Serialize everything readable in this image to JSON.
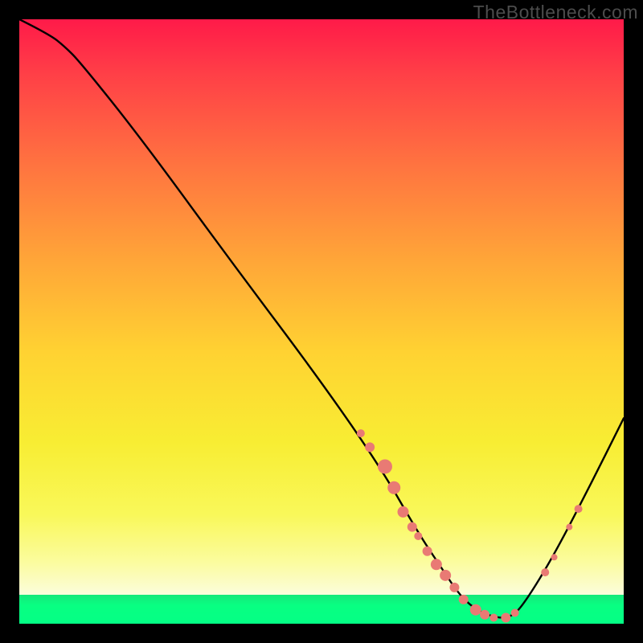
{
  "watermark": "TheBottleneck.com",
  "chart_data": {
    "type": "line",
    "title": "",
    "xlabel": "",
    "ylabel": "",
    "xlim": [
      0,
      100
    ],
    "ylim": [
      0,
      100
    ],
    "curve": {
      "name": "bottleneck-curve",
      "points": [
        {
          "x": 0.0,
          "y": 100.0
        },
        {
          "x": 5.0,
          "y": 97.5
        },
        {
          "x": 7.5,
          "y": 95.5
        },
        {
          "x": 10.0,
          "y": 93.0
        },
        {
          "x": 20.0,
          "y": 80.5
        },
        {
          "x": 35.0,
          "y": 60.0
        },
        {
          "x": 50.0,
          "y": 40.0
        },
        {
          "x": 60.0,
          "y": 25.5
        },
        {
          "x": 66.0,
          "y": 15.0
        },
        {
          "x": 70.0,
          "y": 9.0
        },
        {
          "x": 73.0,
          "y": 4.5
        },
        {
          "x": 76.0,
          "y": 2.0
        },
        {
          "x": 79.0,
          "y": 1.0
        },
        {
          "x": 81.0,
          "y": 1.0
        },
        {
          "x": 83.0,
          "y": 2.5
        },
        {
          "x": 88.0,
          "y": 10.5
        },
        {
          "x": 94.0,
          "y": 22.0
        },
        {
          "x": 100.0,
          "y": 34.0
        }
      ]
    },
    "marker_series": {
      "name": "highlighted-points",
      "color": "#e97a74",
      "points": [
        {
          "x": 56.5,
          "y": 31.5,
          "r": 5
        },
        {
          "x": 58.0,
          "y": 29.2,
          "r": 6
        },
        {
          "x": 60.5,
          "y": 26.0,
          "r": 9
        },
        {
          "x": 62.0,
          "y": 22.5,
          "r": 8
        },
        {
          "x": 63.5,
          "y": 18.5,
          "r": 7
        },
        {
          "x": 65.0,
          "y": 16.0,
          "r": 6
        },
        {
          "x": 66.0,
          "y": 14.5,
          "r": 5
        },
        {
          "x": 67.5,
          "y": 12.0,
          "r": 6
        },
        {
          "x": 69.0,
          "y": 9.8,
          "r": 7
        },
        {
          "x": 70.5,
          "y": 8.0,
          "r": 7
        },
        {
          "x": 72.0,
          "y": 6.0,
          "r": 6
        },
        {
          "x": 73.5,
          "y": 4.0,
          "r": 6
        },
        {
          "x": 75.5,
          "y": 2.3,
          "r": 7
        },
        {
          "x": 77.0,
          "y": 1.5,
          "r": 6
        },
        {
          "x": 78.5,
          "y": 1.0,
          "r": 5
        },
        {
          "x": 80.5,
          "y": 1.0,
          "r": 6
        },
        {
          "x": 82.0,
          "y": 1.8,
          "r": 5
        },
        {
          "x": 87.0,
          "y": 8.5,
          "r": 5
        },
        {
          "x": 88.5,
          "y": 11.0,
          "r": 4
        },
        {
          "x": 91.0,
          "y": 16.0,
          "r": 4
        },
        {
          "x": 92.5,
          "y": 19.0,
          "r": 5
        }
      ]
    },
    "grid": false,
    "legend": false
  }
}
